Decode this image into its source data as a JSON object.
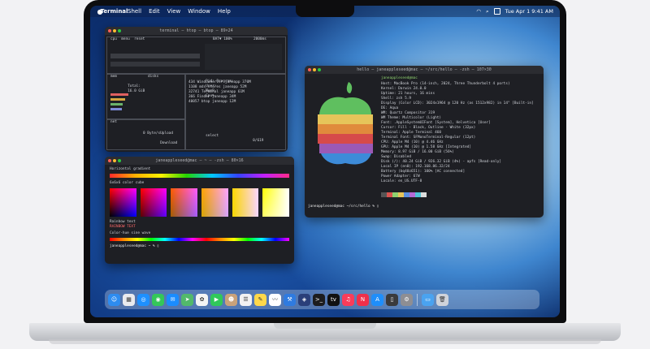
{
  "menubar": {
    "app_name": "Terminal",
    "items": [
      "Shell",
      "Edit",
      "View",
      "Window",
      "Help"
    ],
    "clock": "Tue Apr 1 9:41 AM"
  },
  "btop_window": {
    "title": "terminal — htop — btop — 89×24",
    "cpu_header": "cpu  menu  reset",
    "battery": "BAT▼ 100%",
    "timer": "2000ms",
    "mem_header": "mem",
    "disks_header": "disks",
    "total_label": "Total:",
    "total_value": "16.0 GiB",
    "proc_header": "Pid: Program:",
    "user_label": "User:",
    "memb_label": "MemB",
    "cpu_pct_label": "Cpu%",
    "procs": [
      {
        "pid": "434",
        "prog": "WindowServer",
        "user": "janeapp",
        "mem": "370M"
      },
      {
        "pid": "1108",
        "prog": "mds_stores",
        "user": "janeapp",
        "mem": "52M"
      },
      {
        "pid": "32741",
        "prog": "Terminal",
        "user": "janeapp",
        "mem": "61M"
      },
      {
        "pid": "366",
        "prog": "Finder",
        "user": "janeapp",
        "mem": "34M"
      },
      {
        "pid": "40057",
        "prog": "btop",
        "user": "janeapp",
        "mem": "12M"
      }
    ],
    "net_header": "net",
    "upload_label": "Upload",
    "download_label": "Download",
    "rate_zero": "0 Byte/s",
    "select_label": "select",
    "count": "0/619"
  },
  "colors_window": {
    "title": "janeappleseed@mac — ~ — -zsh — 80×16",
    "horiz_label": "Horizontal gradient",
    "cube_label": "6x6x6 color cube",
    "rainbow_label": "Rainbow text",
    "rainbow_text": "RAINBOW TEXT",
    "sine_label": "Color-hue sine wave",
    "prompt": "janeappleseed@mac"
  },
  "hello_window": {
    "title": "hello — janeappleseed@mac — ~/src/hello — -zsh — 107×30",
    "user_host": "janeappleseed@mac",
    "info_lines": [
      "Host: MacBook Pro (14-inch, 2024, Three Thunderbolt 4 ports)",
      "Kernel: Darwin 24.0.0",
      "Uptime: 21 hours, 16 mins",
      "Shell: zsh 5.9",
      "Display (Color LCD): 3024x1964 @ 120 Hz (as 1512x982) in 14\" [Built-in]",
      "DE: Aqua",
      "WM: Quartz Compositor 319",
      "WM Theme: Multicolor (Light)",
      "Font: .AppleSystemUIFont [System], Helvetica [User]",
      "Cursor: Fill - Black, Outline - White (32px)",
      "Terminal: Apple Terminal 460",
      "Terminal Font: SFMonoTerminal-Regular (12pt)",
      "CPU: Apple M4 (10) @ 4.46 GHz",
      "GPU: Apple M4 (10) @ 1.58 GHz [Integrated]",
      "Memory: 8.97 GiB / 16.00 GiB (56%)",
      "Swap: Disabled",
      "Disk (/): 40.24 GiB / 926.32 GiB (4%) - apfs [Read-only]",
      "Local IP (en0): 192.168.86.32/24",
      "Battery (bq40z651): 100% [AC connected]",
      "Power Adapter: 67W",
      "Locale: en_US.UTF-8"
    ],
    "prompt": "janeappleseed@mac",
    "path": "~/src/hello"
  },
  "dock": {
    "apps": [
      {
        "icon": "finder-icon",
        "color": "#2d8cf0",
        "glyph": "☺"
      },
      {
        "icon": "launchpad-icon",
        "color": "#e9eaee",
        "glyph": "▦"
      },
      {
        "icon": "safari-icon",
        "color": "#1e90ff",
        "glyph": "◎"
      },
      {
        "icon": "messages-icon",
        "color": "#34c759",
        "glyph": "◉"
      },
      {
        "icon": "mail-icon",
        "color": "#1a8cff",
        "glyph": "✉"
      },
      {
        "icon": "maps-icon",
        "color": "#52b96b",
        "glyph": "➤"
      },
      {
        "icon": "photos-icon",
        "color": "#f4f4f4",
        "glyph": "✿"
      },
      {
        "icon": "facetime-icon",
        "color": "#30c85a",
        "glyph": "▶"
      },
      {
        "icon": "contacts-icon",
        "color": "#c9a27a",
        "glyph": "☻"
      },
      {
        "icon": "reminders-icon",
        "color": "#f2f2f2",
        "glyph": "☰"
      },
      {
        "icon": "notes-icon",
        "color": "#ffd84a",
        "glyph": "✎"
      },
      {
        "icon": "freeform-icon",
        "color": "#ffffff",
        "glyph": "〰"
      },
      {
        "icon": "xcode-icon",
        "color": "#2f7be0",
        "glyph": "⚒"
      },
      {
        "icon": "instruments-icon",
        "color": "#2a3f7a",
        "glyph": "◈"
      },
      {
        "icon": "terminal-icon",
        "color": "#1c1c1e",
        "glyph": ">_"
      },
      {
        "icon": "tv-icon",
        "color": "#111111",
        "glyph": "tv"
      },
      {
        "icon": "music-icon",
        "color": "#fa3c5a",
        "glyph": "♫"
      },
      {
        "icon": "news-icon",
        "color": "#f0304a",
        "glyph": "N"
      },
      {
        "icon": "appstore-icon",
        "color": "#1f8efa",
        "glyph": "A"
      },
      {
        "icon": "iphone-mirroring-icon",
        "color": "#3a3a3c",
        "glyph": "▯"
      },
      {
        "icon": "settings-icon",
        "color": "#8e8e93",
        "glyph": "⚙"
      }
    ],
    "right_apps": [
      {
        "icon": "downloads-folder-icon",
        "color": "#4aa3f0",
        "glyph": "▭"
      },
      {
        "icon": "trash-icon",
        "color": "#cfd3da",
        "glyph": "🗑"
      }
    ]
  }
}
